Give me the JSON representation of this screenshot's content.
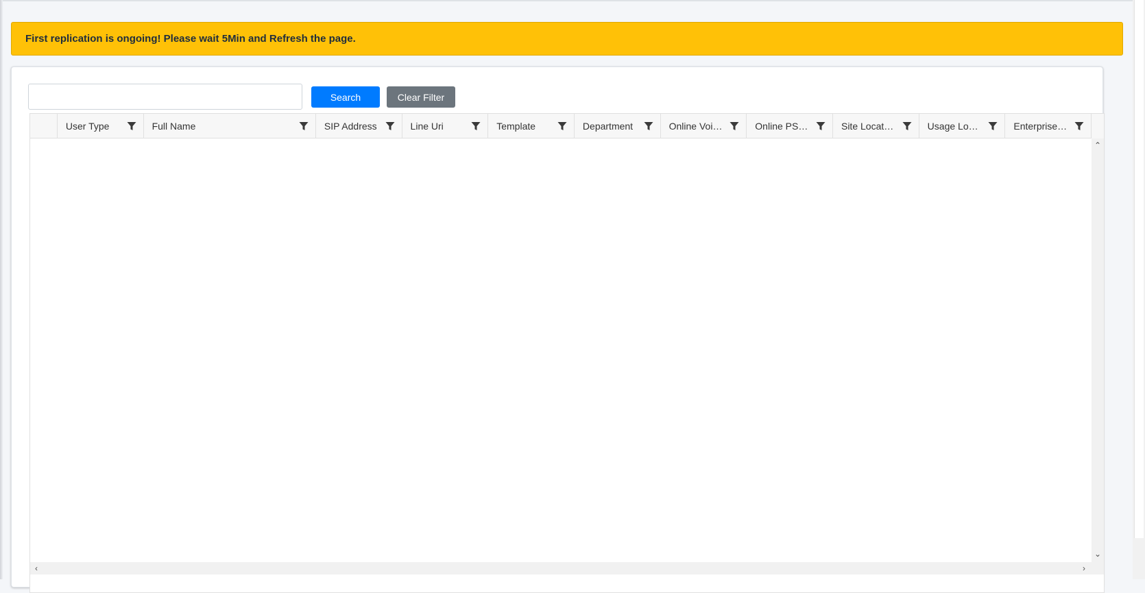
{
  "alert": {
    "message": "First replication is ongoing! Please wait 5Min and Refresh the page.",
    "color": "#ffc107"
  },
  "search": {
    "value": "",
    "placeholder": "",
    "button_label": "Search",
    "clear_label": "Clear Filter"
  },
  "colors": {
    "primary": "#007bff",
    "secondary": "#6c757d"
  },
  "grid": {
    "columns": [
      {
        "label": "User Type"
      },
      {
        "label": "Full Name"
      },
      {
        "label": "SIP Address"
      },
      {
        "label": "Line Uri"
      },
      {
        "label": "Template"
      },
      {
        "label": "Department"
      },
      {
        "label": "Online Voic…"
      },
      {
        "label": "Online PST…"
      },
      {
        "label": "Site Location"
      },
      {
        "label": "Usage Loc…"
      },
      {
        "label": "Enterprise…"
      }
    ],
    "rows": []
  },
  "icons": {
    "filter": "filter-icon",
    "scroll_up": "chevron-up-icon",
    "scroll_down": "chevron-down-icon",
    "scroll_left": "chevron-left-icon",
    "scroll_right": "chevron-right-icon"
  }
}
